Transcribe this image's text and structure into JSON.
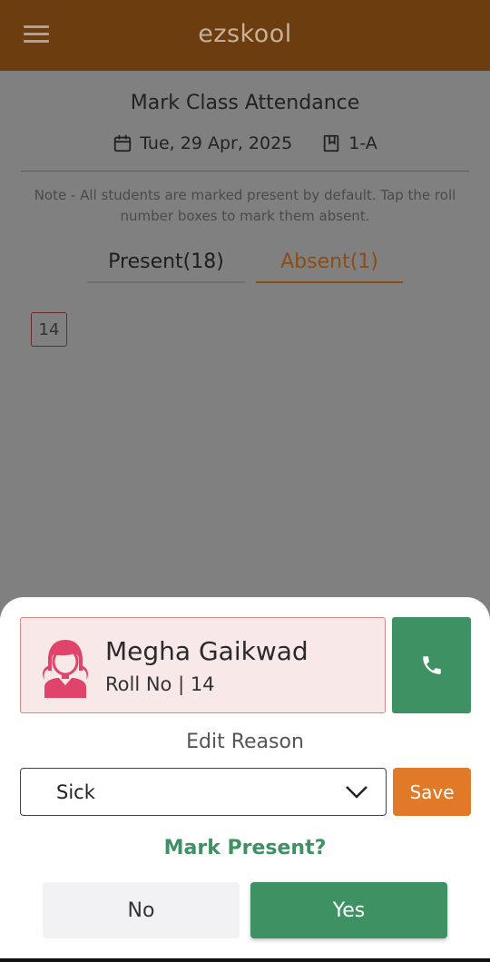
{
  "app": {
    "title": "ezskool"
  },
  "page": {
    "title": "Mark Class Attendance",
    "date": "Tue, 29 Apr, 2025",
    "class_name": "1-A",
    "note": "Note - All students are marked present by default. Tap the roll number boxes to mark them absent."
  },
  "tabs": {
    "present": "Present(18)",
    "absent": "Absent(1)",
    "active": "absent"
  },
  "absent_rolls": [
    "14"
  ],
  "sheet": {
    "student_name": "Megha Gaikwad",
    "student_roll": "Roll No | 14",
    "edit_reason_label": "Edit Reason",
    "reason_value": "Sick",
    "save_label": "Save",
    "mark_present_prompt": "Mark Present?",
    "no_label": "No",
    "yes_label": "Yes"
  },
  "icons": {
    "menu": "hamburger-icon",
    "date": "calendar-icon",
    "class": "class-book-icon",
    "avatar": "girl-avatar-icon",
    "call": "phone-icon",
    "dropdown": "chevron-down-icon"
  },
  "colors": {
    "appbar": "#6b3d0f",
    "accent": "#8a4d15",
    "green": "#3e9163",
    "save": "#e07a28",
    "card_bg": "#f8e8e8",
    "avatar": "#e0446a"
  }
}
